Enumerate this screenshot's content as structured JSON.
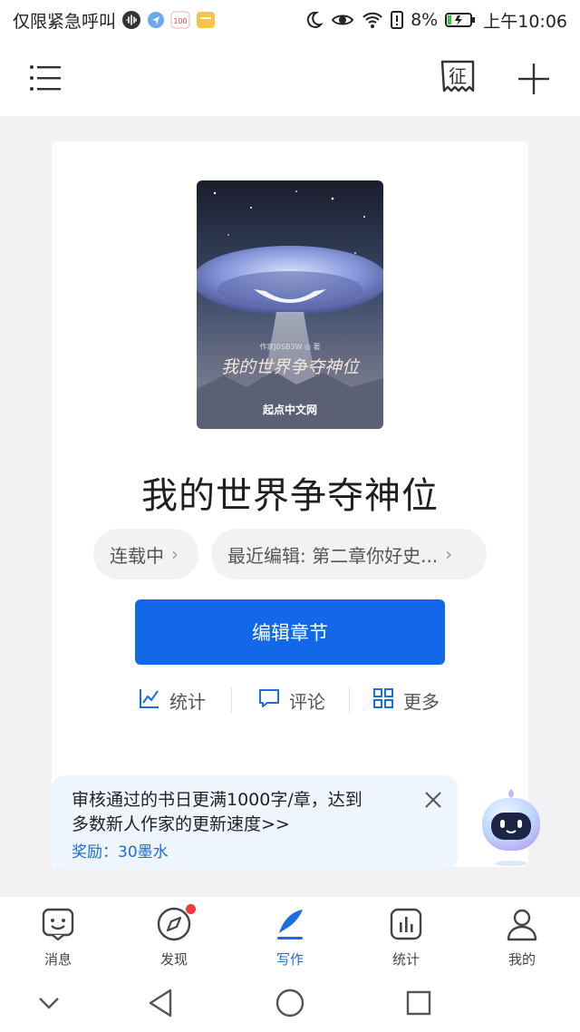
{
  "status_bar": {
    "carrier": "仅限紧急呼叫",
    "battery": "8%",
    "time": "上午10:06"
  },
  "app_bar": {
    "menu_icon": "menu-icon",
    "solicit_icon_text": "征",
    "add_icon": "plus-icon"
  },
  "book": {
    "title": "我的世界争夺神位",
    "cover": {
      "author_line": "作家J0SB3W ◎ 著",
      "title_text": "我的世界争夺神位",
      "publisher": "起点中文网"
    },
    "status_chip": "连载中",
    "recent_edit_chip": "最近编辑: 第二章你好史...",
    "edit_button": "编辑章节",
    "actions": [
      {
        "label": "统计",
        "icon": "chart-icon"
      },
      {
        "label": "评论",
        "icon": "comment-icon"
      },
      {
        "label": "更多",
        "icon": "grid-icon"
      }
    ]
  },
  "tip": {
    "line1": "审核通过的书日更满1000字/章，达到",
    "line2": "多数新人作家的更新速度>>",
    "reward": "奖励：30墨水"
  },
  "bottom_nav": [
    {
      "label": "消息",
      "icon": "message-icon",
      "active": false
    },
    {
      "label": "发现",
      "icon": "compass-icon",
      "active": false,
      "badge": true
    },
    {
      "label": "写作",
      "icon": "pen-icon",
      "active": true
    },
    {
      "label": "统计",
      "icon": "stats-icon",
      "active": false
    },
    {
      "label": "我的",
      "icon": "profile-icon",
      "active": false
    }
  ],
  "colors": {
    "accent": "#1268e8",
    "tip_bg": "#eef5fd",
    "badge": "#f03a3a"
  }
}
